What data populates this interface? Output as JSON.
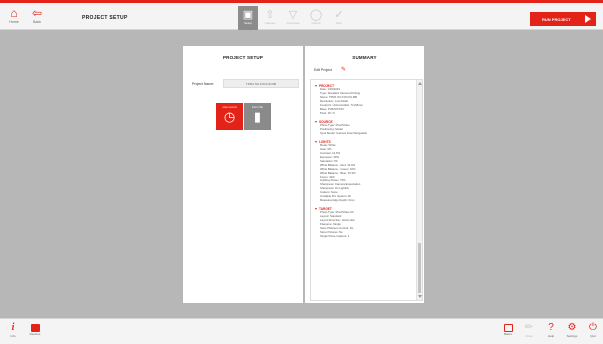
{
  "topbar": {
    "home": {
      "label": "Home",
      "icon": "home-icon"
    },
    "back": {
      "label": "Back",
      "icon": "back-arrow-icon"
    },
    "title": "PROJECT SETUP",
    "steps": [
      {
        "label": "Setup",
        "icon": "camera-icon",
        "active": true
      },
      {
        "label": "Capture",
        "icon": "capture-icon",
        "active": false
      },
      {
        "label": "Compose",
        "icon": "compose-icon",
        "active": false
      },
      {
        "label": "Output",
        "icon": "output-icon",
        "active": false
      },
      {
        "label": "Edit",
        "icon": "edit-icon",
        "active": false
      }
    ],
    "run_label": "RUN PROJECT"
  },
  "left_panel": {
    "title": "PROJECT SETUP",
    "project_name_label": "Project Name:",
    "project_name_value": "TPM1 NO FOCUS MB",
    "sources": [
      {
        "label": "Live record",
        "icon": "timer-icon",
        "selected": true
      },
      {
        "label": "From file",
        "icon": "file-icon",
        "selected": false
      }
    ]
  },
  "summary": {
    "title": "SUMMARY",
    "edit_label": "Edit Project",
    "sections": [
      {
        "heading": "PROJECT",
        "rows": [
          "Date: 1/15/2019",
          "Type: Standard Camera Printing",
          "Name: TPM1 NO FOCUS MB",
          "Resolution: Low Detail",
          "Footprint: Unknown/Ext, 71x55mm",
          "Base: PIXMOTION",
          "Pixel: 15 / 9"
        ]
      },
      {
        "heading": "SOURCE",
        "rows": [
          "Photo Type: Pixel/Video",
          "Positioning: Model",
          "Input Model: Camera Interchangeable"
        ]
      },
      {
        "heading": "LIGHTS",
        "rows": [
          "Mode: White",
          "Gain: 0%",
          "Contrast: 14.6%",
          "Exposure: 40%",
          "Saturation: 50",
          "White Balance - Red: 14.6%",
          "White Balance - Green: 10%",
          "White Balance - Blue: 15.3%",
          "Focus: 42%",
          "Lighting Power: 70%",
          "Sharpness: Camera Expectation",
          "Sharpness: On Lighthin",
          "Codecs: None",
          "Unstable Pro System: All",
          "Measured Algo Depth: 0mm"
        ]
      },
      {
        "heading": "TARGET",
        "rows": [
          "Photo Type: Pixel/Video Mr",
          "Layout: Standard",
          "Layout Direction: Horizontal",
          "Filename: Single",
          "Store Platinum Control: No",
          "Store Pictures: No",
          "Single Piece Capture: 1"
        ]
      }
    ]
  },
  "bottombar": {
    "info": {
      "label": "Info",
      "icon": "info-icon"
    },
    "devices": {
      "label": "Devices",
      "icon": "monitor-icon"
    },
    "right": [
      {
        "label": "Macro",
        "icon": "macro-icon",
        "dim": false
      },
      {
        "label": "Draw",
        "icon": "pencil-icon",
        "dim": true
      },
      {
        "label": "Help",
        "icon": "help-icon",
        "dim": false
      },
      {
        "label": "Settings",
        "icon": "gear-icon",
        "dim": false
      },
      {
        "label": "Quit",
        "icon": "power-icon",
        "dim": false
      }
    ]
  },
  "colors": {
    "accent": "#e42318",
    "background": "#b7b7b7"
  }
}
